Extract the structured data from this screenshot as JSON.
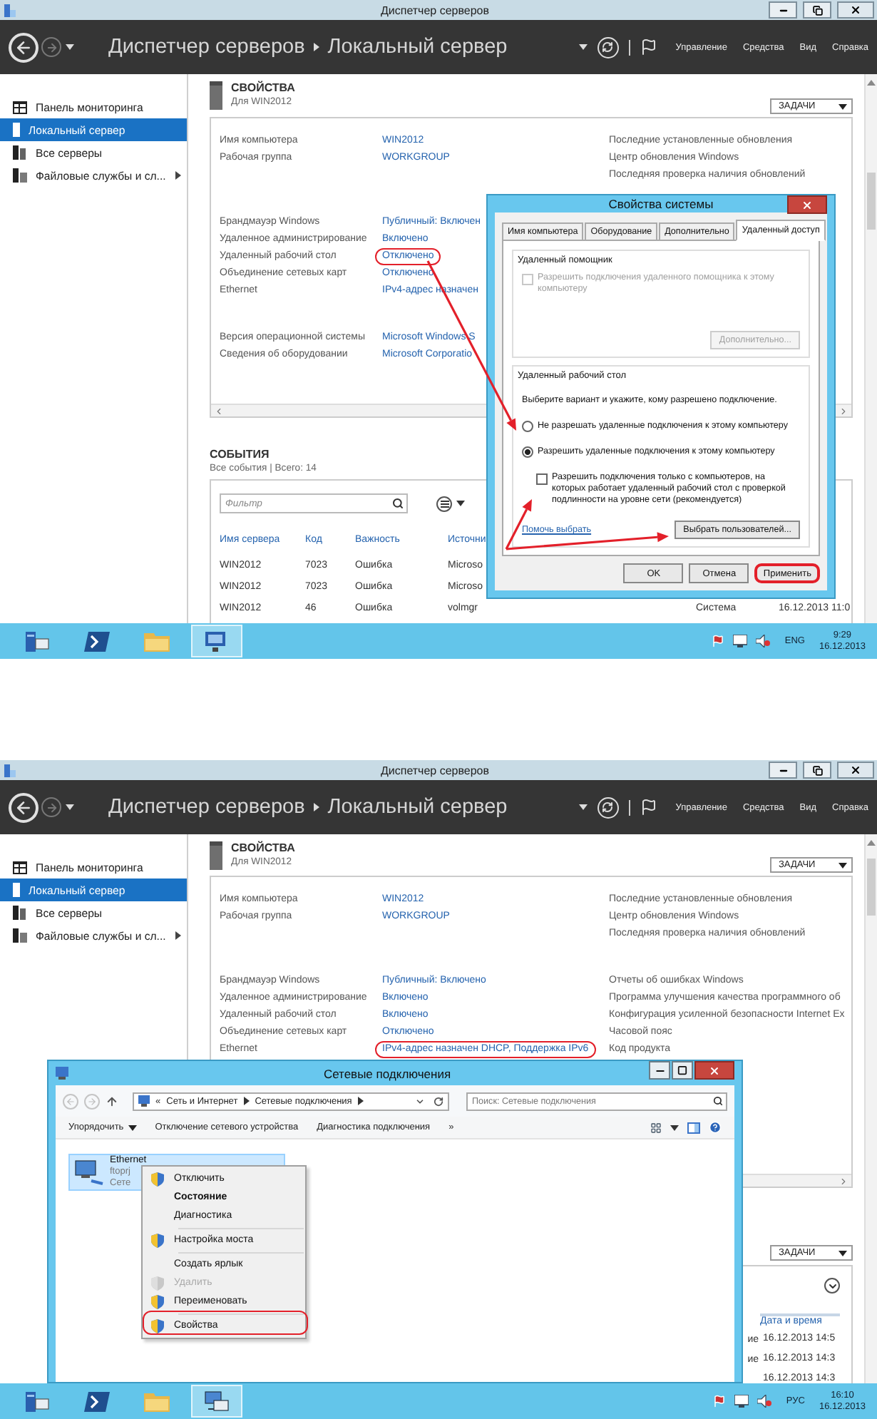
{
  "screens": [
    {
      "kind": "system-properties",
      "window_title": "Диспетчер серверов",
      "breadcrumb": [
        "Диспетчер серверов",
        "Локальный сервер"
      ],
      "menu": [
        "Управление",
        "Средства",
        "Вид",
        "Справка"
      ],
      "sidebar": [
        {
          "kind": "dashboard",
          "label": "Панель мониторинга",
          "selected": false,
          "expandable": false
        },
        {
          "kind": "server",
          "label": "Локальный сервер",
          "selected": true,
          "expandable": false
        },
        {
          "kind": "servers",
          "label": "Все серверы",
          "selected": false,
          "expandable": false
        },
        {
          "kind": "files",
          "label": "Файловые службы и сл...",
          "selected": false,
          "expandable": true
        }
      ],
      "properties": {
        "title": "СВОЙСТВА",
        "subtitle": "Для WIN2012",
        "tasks": "ЗАДАЧИ",
        "groups": [
          {
            "rows": [
              {
                "label": "Имя компьютера",
                "value": "WIN2012",
                "highlighted": false
              },
              {
                "label": "Рабочая группа",
                "value": "WORKGROUP",
                "highlighted": false
              }
            ],
            "side": [
              "Последние установленные обновления",
              "Центр обновления Windows",
              "Последняя проверка наличия обновлений"
            ]
          },
          {
            "rows": [
              {
                "label": "Брандмауэр Windows",
                "value": "Публичный: Включен",
                "highlighted": false
              },
              {
                "label": "Удаленное администрирование",
                "value": "Включено",
                "highlighted": false
              },
              {
                "label": "Удаленный рабочий стол",
                "value": "Отключено",
                "highlighted": true
              },
              {
                "label": "Объединение сетевых карт",
                "value": "Отключено",
                "highlighted": false
              },
              {
                "label": "Ethernet",
                "value": "IPv4-адрес назначен",
                "highlighted": false
              }
            ]
          },
          {
            "rows": [
              {
                "label": "Версия операционной системы",
                "value": "Microsoft Windows S",
                "highlighted": false
              },
              {
                "label": "Сведения об оборудовании",
                "value": "Microsoft Corporatio",
                "highlighted": false
              }
            ]
          }
        ]
      },
      "events": {
        "title": "СОБЫТИЯ",
        "subtitle": "Все события | Всего: 14",
        "filter_placeholder": "Фильтр",
        "columns": [
          "Имя сервера",
          "Код",
          "Важность",
          "Источни"
        ],
        "rows": [
          [
            "WIN2012",
            "7023",
            "Ошибка",
            "Microso"
          ],
          [
            "WIN2012",
            "7023",
            "Ошибка",
            "Microso"
          ],
          [
            "WIN2012",
            "46",
            "Ошибка",
            "volmgr",
            "Система",
            "16.12.2013 11:0"
          ]
        ]
      },
      "dialog": {
        "title": "Свойства системы",
        "tabs": [
          {
            "label": "Имя компьютера",
            "selected": false
          },
          {
            "label": "Оборудование",
            "selected": false
          },
          {
            "label": "Дополнительно",
            "selected": false
          },
          {
            "label": "Удаленный доступ",
            "selected": true
          }
        ],
        "assistance": {
          "title": "Удаленный помощник",
          "checkbox": {
            "label": "Разрешить подключения удаленного помощника к этому компьютеру",
            "checked": false,
            "disabled": true
          },
          "button": {
            "label": "Дополнительно...",
            "disabled": true
          }
        },
        "remote": {
          "title": "Удаленный рабочий стол",
          "hint": "Выберите вариант и укажите, кому разрешено подключение.",
          "options": [
            {
              "label": "Не разрешать удаленные подключения к этому компьютеру",
              "selected": false
            },
            {
              "label": "Разрешить удаленные подключения к этому компьютеру",
              "selected": true
            }
          ],
          "nla": {
            "label": "Разрешить подключения только с компьютеров, на которых работает удаленный рабочий стол с проверкой подлинности на уровне сети (рекомендуется)",
            "checked": false,
            "disabled": false
          },
          "help_link": "Помочь выбрать",
          "users_button": "Выбрать пользователей..."
        },
        "buttons": [
          {
            "label": "OK",
            "highlighted": false
          },
          {
            "label": "Отмена",
            "highlighted": false
          },
          {
            "label": "Применить",
            "highlighted": true
          }
        ]
      },
      "taskbar": {
        "apps": [
          {
            "kind": "server",
            "selected": false
          },
          {
            "kind": "terminal",
            "selected": false
          },
          {
            "kind": "folder",
            "selected": false
          },
          {
            "kind": "remote",
            "selected": true
          }
        ],
        "language": "ENG",
        "time": "9:29",
        "date": "16.12.2013"
      }
    },
    {
      "kind": "network-connections",
      "window_title": "Диспетчер серверов",
      "breadcrumb": [
        "Диспетчер серверов",
        "Локальный сервер"
      ],
      "menu": [
        "Управление",
        "Средства",
        "Вид",
        "Справка"
      ],
      "sidebar": [
        {
          "kind": "dashboard",
          "label": "Панель мониторинга",
          "selected": false,
          "expandable": false
        },
        {
          "kind": "server",
          "label": "Локальный сервер",
          "selected": true,
          "expandable": false
        },
        {
          "kind": "servers",
          "label": "Все серверы",
          "selected": false,
          "expandable": false
        },
        {
          "kind": "files",
          "label": "Файловые службы и сл...",
          "selected": false,
          "expandable": true
        }
      ],
      "properties": {
        "title": "СВОЙСТВА",
        "subtitle": "Для WIN2012",
        "tasks": "ЗАДАЧИ",
        "groups": [
          {
            "rows": [
              {
                "label": "Имя компьютера",
                "value": "WIN2012",
                "highlighted": false
              },
              {
                "label": "Рабочая группа",
                "value": "WORKGROUP",
                "highlighted": false
              }
            ],
            "side": [
              "Последние установленные обновления",
              "Центр обновления Windows",
              "Последняя проверка наличия обновлений"
            ]
          },
          {
            "rows": [
              {
                "label": "Брандмауэр Windows",
                "value": "Публичный: Включено",
                "highlighted": false
              },
              {
                "label": "Удаленное администрирование",
                "value": "Включено",
                "highlighted": false
              },
              {
                "label": "Удаленный рабочий стол",
                "value": "Включено",
                "highlighted": false
              },
              {
                "label": "Объединение сетевых карт",
                "value": "Отключено",
                "highlighted": false
              },
              {
                "label": "Ethernet",
                "value": "IPv4-адрес назначен DHCP, Поддержка IPv6",
                "highlighted": true
              }
            ],
            "side": [
              "Отчеты об ошибках Windows",
              "Программа улучшения качества программного об",
              "Конфигурация усиленной безопасности Internet Ex",
              "Часовой пояс",
              "Код продукта"
            ]
          }
        ]
      },
      "events": {
        "tasks": "ЗАДАЧИ",
        "column": "Дата и время",
        "rows": [
          {
            "prefix": "ие",
            "date": "16.12.2013 14:5"
          },
          {
            "prefix": "ие",
            "date": "16.12.2013 14:3"
          },
          {
            "date": "16.12.2013 14:3"
          }
        ]
      },
      "dialog": {
        "title": "Сетевые подключения",
        "path_prefix": "«",
        "path": [
          "Сеть и Интернет",
          "Сетевые подключения"
        ],
        "search_placeholder": "Поиск: Сетевые подключения",
        "toolbar": [
          "Упорядочить",
          "Отключение сетевого устройства",
          "Диагностика подключения"
        ],
        "more": "»",
        "item": {
          "name": "Ethernet",
          "lines": [
            "ftoprj",
            "Сете"
          ]
        },
        "menu": [
          {
            "label": "Отключить",
            "shield": true,
            "bold": false,
            "disabled": false,
            "separator_before": false,
            "highlighted": false
          },
          {
            "label": "Состояние",
            "shield": false,
            "bold": true,
            "disabled": false,
            "separator_before": false,
            "highlighted": false
          },
          {
            "label": "Диагностика",
            "shield": false,
            "bold": false,
            "disabled": false,
            "separator_before": false,
            "highlighted": false
          },
          {
            "label": "Настройка моста",
            "shield": true,
            "bold": false,
            "disabled": false,
            "separator_before": true,
            "highlighted": false
          },
          {
            "label": "Создать ярлык",
            "shield": false,
            "bold": false,
            "disabled": false,
            "separator_before": true,
            "highlighted": false
          },
          {
            "label": "Удалить",
            "shield": true,
            "bold": false,
            "disabled": true,
            "separator_before": false,
            "highlighted": false
          },
          {
            "label": "Переименовать",
            "shield": true,
            "bold": false,
            "disabled": false,
            "separator_before": false,
            "highlighted": false
          },
          {
            "label": "Свойства",
            "shield": true,
            "bold": false,
            "disabled": false,
            "separator_before": true,
            "highlighted": true
          }
        ]
      },
      "taskbar": {
        "apps": [
          {
            "kind": "server",
            "selected": false
          },
          {
            "kind": "terminal",
            "selected": false
          },
          {
            "kind": "folder",
            "selected": false
          },
          {
            "kind": "network",
            "selected": true
          }
        ],
        "language": "РУС",
        "time": "16:10",
        "date": "16.12.2013"
      }
    }
  ]
}
